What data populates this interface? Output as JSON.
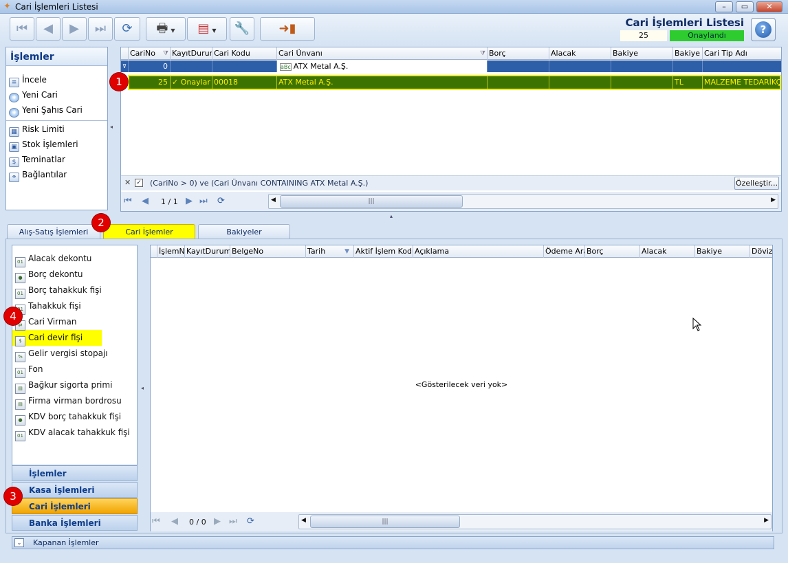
{
  "window": {
    "title": "Cari İşlemleri Listesi",
    "app_icon": "butterfly-icon"
  },
  "header": {
    "title": "Cari İşlemleri Listesi",
    "count": "25",
    "status": "Onaylandı",
    "status_color": "#2ecc2e"
  },
  "toolbar": {
    "buttons": [
      "first-icon",
      "prev-icon",
      "next-icon",
      "last-icon",
      "refresh-icon",
      "print-icon",
      "pdf-export-icon",
      "tools-icon",
      "exit-icon"
    ]
  },
  "islemler": {
    "title": "İşlemler",
    "items": [
      "İncele",
      "Yeni Cari",
      "Yeni Şahıs Cari"
    ],
    "items2": [
      "Risk Limiti",
      "Stok İşlemleri",
      "Teminatlar",
      "Bağlantılar"
    ]
  },
  "grid1": {
    "columns": [
      "CariNo",
      "KayıtDurumu",
      "Cari Kodu",
      "Cari Ünvanı",
      "Borç",
      "Alacak",
      "Bakiye",
      "Bakiye D",
      "Cari Tip Adı"
    ],
    "filter": {
      "cari_no": "0",
      "cari_unvani": "ATX Metal A.Ş."
    },
    "row": {
      "cari_no": "25",
      "kayit": "Onaylar",
      "kod": "00018",
      "unvan": "ATX Metal A.Ş.",
      "borc": "",
      "alacak": "",
      "bakiye": "",
      "bakiye_d": "TL",
      "tip": "MALZEME TEDARİKÇİLE"
    },
    "filter_text": "(CariNo > 0) ve (Cari Ünvanı CONTAINING ATX Metal A.Ş.)",
    "customize": "Özelleştir...",
    "page": "1 / 1"
  },
  "tabs": [
    "Alış-Satış İşlemleri",
    "Cari İşlemler",
    "Bakiyeler"
  ],
  "doclist": [
    "Alacak dekontu",
    "Borç dekontu",
    "Borç tahakkuk fişi",
    "Tahakkuk fişi",
    "Cari Virman",
    "Cari devir fişi",
    "Gelir vergisi stopajı",
    "Fon",
    "Bağkur sigorta primi",
    "Firma virman bordrosu",
    "KDV borç tahakkuk fişi",
    "KDV alacak tahakkuk fişi"
  ],
  "groups": [
    "İşlemler",
    "Kasa İşlemleri",
    "Cari İşlemleri",
    "Banka İşlemleri"
  ],
  "grid2": {
    "columns": [
      "İşlemNo",
      "KayıtDurumu",
      "BelgeNo",
      "Tarih",
      "Aktif İşlem Kodu",
      "Açıklama",
      "Ödeme Ara",
      "Borç",
      "Alacak",
      "Bakiye",
      "Döviz"
    ],
    "empty": "<Gösterilecek veri yok>",
    "page": "0 / 0"
  },
  "kapanan": "Kapanan İşlemler",
  "badges": [
    "1",
    "2",
    "3",
    "4"
  ]
}
